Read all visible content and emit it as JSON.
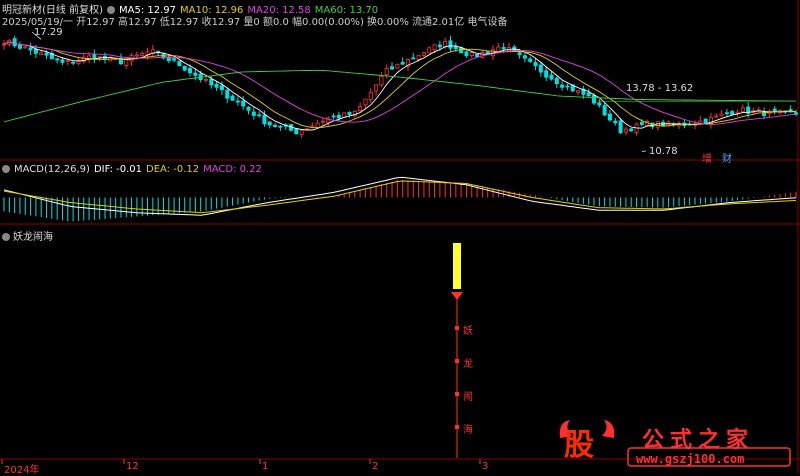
{
  "price_header": {
    "stock": "明冠新材(日线 前复权)",
    "ma5": "MA5: 12.97",
    "ma10": "MA10: 12.96",
    "ma20": "MA20: 12.58",
    "ma60": "MA60: 13.70",
    "info": "2025/05/19/一 开12.97 高12.97 低12.97 收12.97 量0 额0.0 幅0.00(0.00%) 换0.00% 流通2.01亿 电气设备"
  },
  "annotations": {
    "high": "17.29",
    "low": "10.78",
    "range": "13.78 - 13.62",
    "tag_zeng": "增",
    "tag_cai": "财"
  },
  "macd_header": {
    "name": "MACD(12,26,9)",
    "dif": "DIF: -0.01",
    "dea": "DEA: -0.12",
    "macd": "MACD: 0.22"
  },
  "indicator": {
    "name": "妖龙闹海",
    "chars": [
      "妖",
      "龙",
      "闹",
      "海"
    ]
  },
  "x_axis": {
    "labels": [
      "2024年",
      "12",
      "1",
      "2",
      "3"
    ]
  },
  "watermark": {
    "gu": "股",
    "title": "公式之家",
    "url": "www.gszj100.com"
  },
  "colors": {
    "up": "#ff3030",
    "down": "#00e0e0",
    "ma5": "#ffffff",
    "ma10": "#e0d000",
    "ma20": "#e040e0",
    "ma60": "#40d040",
    "grid": "#8b0000"
  },
  "chart_data": {
    "type": "candlestick",
    "price_range": [
      10.4,
      18.3
    ],
    "high_point": 17.29,
    "low_point": 10.78,
    "price_key_points": [
      17.2,
      16.6,
      15.9,
      16.3,
      16.0,
      16.6,
      15.8,
      14.7,
      13.6,
      12.4,
      11.9,
      12.7,
      13.0,
      15.4,
      16.3,
      17.1,
      16.3,
      16.9,
      15.8,
      14.7,
      13.9,
      12.0,
      12.4,
      12.3,
      12.6,
      13.2,
      13.0,
      12.97
    ],
    "ma60_key_points": [
      12.5,
      13.7,
      14.8,
      15.4,
      15.5,
      15.1,
      14.6,
      14.0,
      13.8,
      13.75,
      13.7
    ],
    "macd_range": [
      -1.2,
      1.0
    ],
    "macd_histogram_key_points": [
      -0.55,
      -0.95,
      -0.75,
      -0.55,
      -0.05,
      0.05,
      0.7,
      0.55,
      0.1,
      -0.35,
      -0.4,
      -0.15,
      0.22
    ],
    "dif_key_points": [
      0.3,
      -0.35,
      -0.6,
      -0.7,
      -0.2,
      0.2,
      0.8,
      0.5,
      -0.15,
      -0.5,
      -0.5,
      -0.2,
      -0.01
    ],
    "dea_key_points": [
      0.25,
      -0.2,
      -0.45,
      -0.6,
      -0.3,
      0.05,
      0.65,
      0.55,
      0.0,
      -0.4,
      -0.45,
      -0.25,
      -0.12
    ]
  }
}
